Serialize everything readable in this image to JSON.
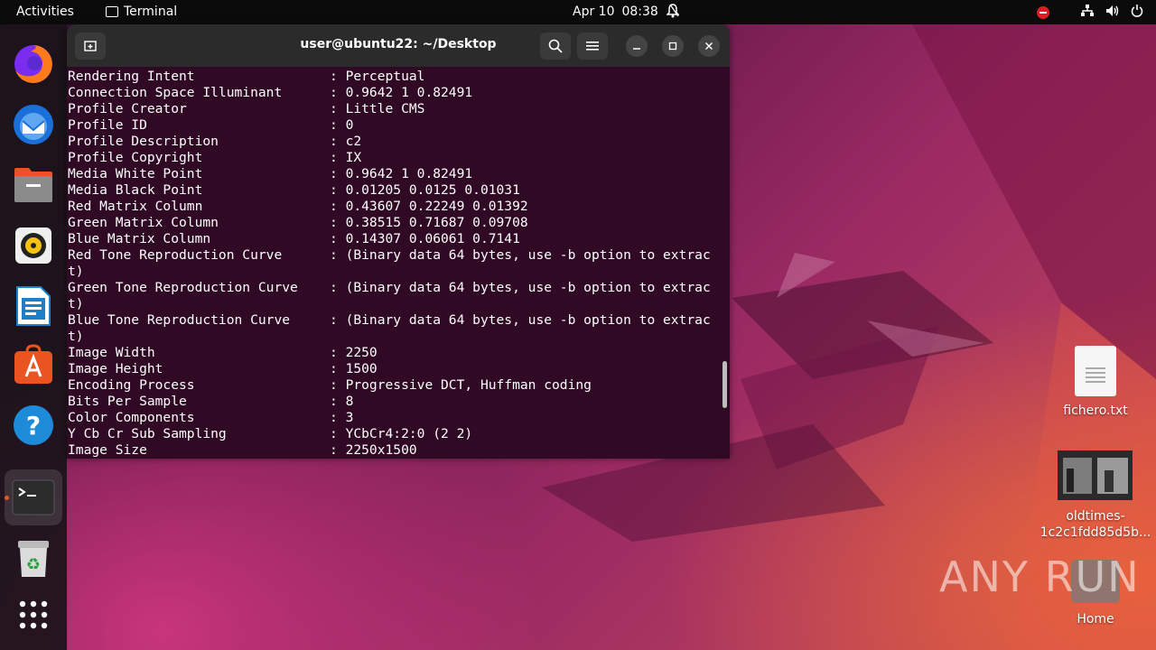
{
  "topbar": {
    "activities": "Activities",
    "app_name": "Terminal",
    "date": "Apr 10",
    "time": "08:38"
  },
  "dock": {
    "items": [
      "firefox",
      "thunderbird",
      "files",
      "rhythmbox",
      "libreoffice-writer",
      "app-center",
      "help",
      "terminal",
      "trash",
      "show-apps"
    ]
  },
  "terminal": {
    "title": "user@ubuntu22: ~/Desktop",
    "lines": [
      {
        "key": "Rendering Intent",
        "value": "Perceptual"
      },
      {
        "key": "Connection Space Illuminant",
        "value": "0.9642 1 0.82491"
      },
      {
        "key": "Profile Creator",
        "value": "Little CMS"
      },
      {
        "key": "Profile ID",
        "value": "0"
      },
      {
        "key": "Profile Description",
        "value": "c2"
      },
      {
        "key": "Profile Copyright",
        "value": "IX"
      },
      {
        "key": "Media White Point",
        "value": "0.9642 1 0.82491"
      },
      {
        "key": "Media Black Point",
        "value": "0.01205 0.0125 0.01031"
      },
      {
        "key": "Red Matrix Column",
        "value": "0.43607 0.22249 0.01392"
      },
      {
        "key": "Green Matrix Column",
        "value": "0.38515 0.71687 0.09708"
      },
      {
        "key": "Blue Matrix Column",
        "value": "0.14307 0.06061 0.7141"
      },
      {
        "key": "Red Tone Reproduction Curve",
        "value": "(Binary data 64 bytes, use -b option to extrac",
        "wrap": "t)"
      },
      {
        "key": "Green Tone Reproduction Curve",
        "value": "(Binary data 64 bytes, use -b option to extrac",
        "wrap": "t)"
      },
      {
        "key": "Blue Tone Reproduction Curve",
        "value": "(Binary data 64 bytes, use -b option to extrac",
        "wrap": "t)"
      },
      {
        "key": "Image Width",
        "value": "2250"
      },
      {
        "key": "Image Height",
        "value": "1500"
      },
      {
        "key": "Encoding Process",
        "value": "Progressive DCT, Huffman coding"
      },
      {
        "key": "Bits Per Sample",
        "value": "8"
      },
      {
        "key": "Color Components",
        "value": "3"
      },
      {
        "key": "Y Cb Cr Sub Sampling",
        "value": "YCbCr4:2:0 (2 2)"
      },
      {
        "key": "Image Size",
        "value": "2250x1500"
      }
    ]
  },
  "desktop": {
    "file1": "fichero.txt",
    "file2_line1": "oldtimes-",
    "file2_line2": "1c2c1fdd85d5b...",
    "home": "Home",
    "watermark": "ANY RUN"
  }
}
